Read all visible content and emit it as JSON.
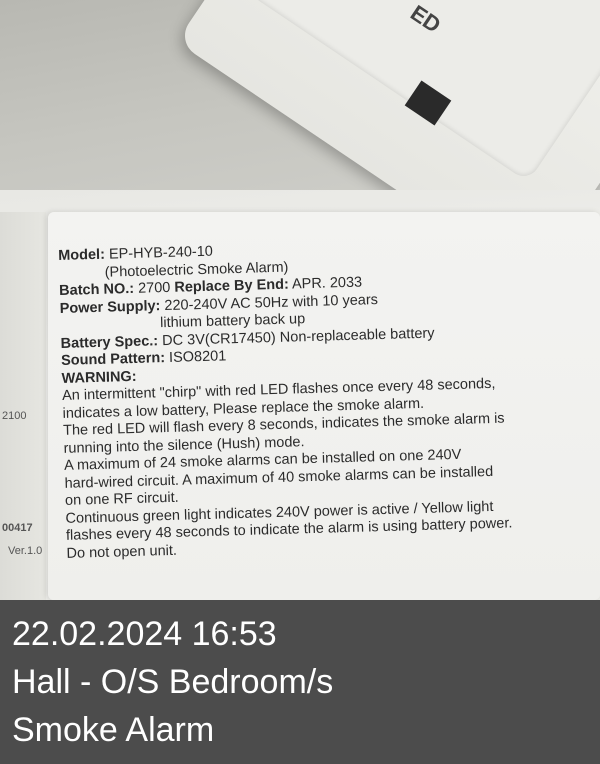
{
  "photo": {
    "device_text": "ED",
    "edge_codes": [
      "2100",
      "00417",
      "Ver.1.0"
    ],
    "label": {
      "model_key": "Model:",
      "model_value": "EP-HYB-240-10",
      "model_desc": "(Photoelectric Smoke Alarm)",
      "batch_key": "Batch NO.:",
      "batch_value": "2700",
      "replace_key": "Replace By End:",
      "replace_value": "APR. 2033",
      "power_key": "Power Supply:",
      "power_value": "220-240V AC 50Hz with 10 years",
      "power_value_2": "lithium battery back up",
      "battery_key": "Battery Spec.:",
      "battery_value": "DC 3V(CR17450) Non-replaceable battery",
      "sound_key": "Sound Pattern:",
      "sound_value": "ISO8201",
      "warning_title": "WARNING:",
      "warnings": [
        "An intermittent \"chirp\" with red LED flashes once every 48 seconds,",
        "indicates a low battery, Please replace the smoke alarm.",
        "The red LED will flash every 8 seconds, indicates the smoke alarm is",
        "running into the silence (Hush) mode.",
        "A maximum of 24 smoke alarms can be installed on one 240V",
        "hard-wired circuit. A maximum of 40 smoke alarms can be installed",
        "on one RF circuit.",
        "Continuous green light indicates 240V power is active / Yellow light",
        "flashes every 48 seconds to indicate the alarm is using battery power.",
        "Do not open unit."
      ]
    }
  },
  "caption": {
    "datetime": "22.02.2024 16:53",
    "location": "Hall - O/S Bedroom/s",
    "item": "Smoke Alarm"
  }
}
